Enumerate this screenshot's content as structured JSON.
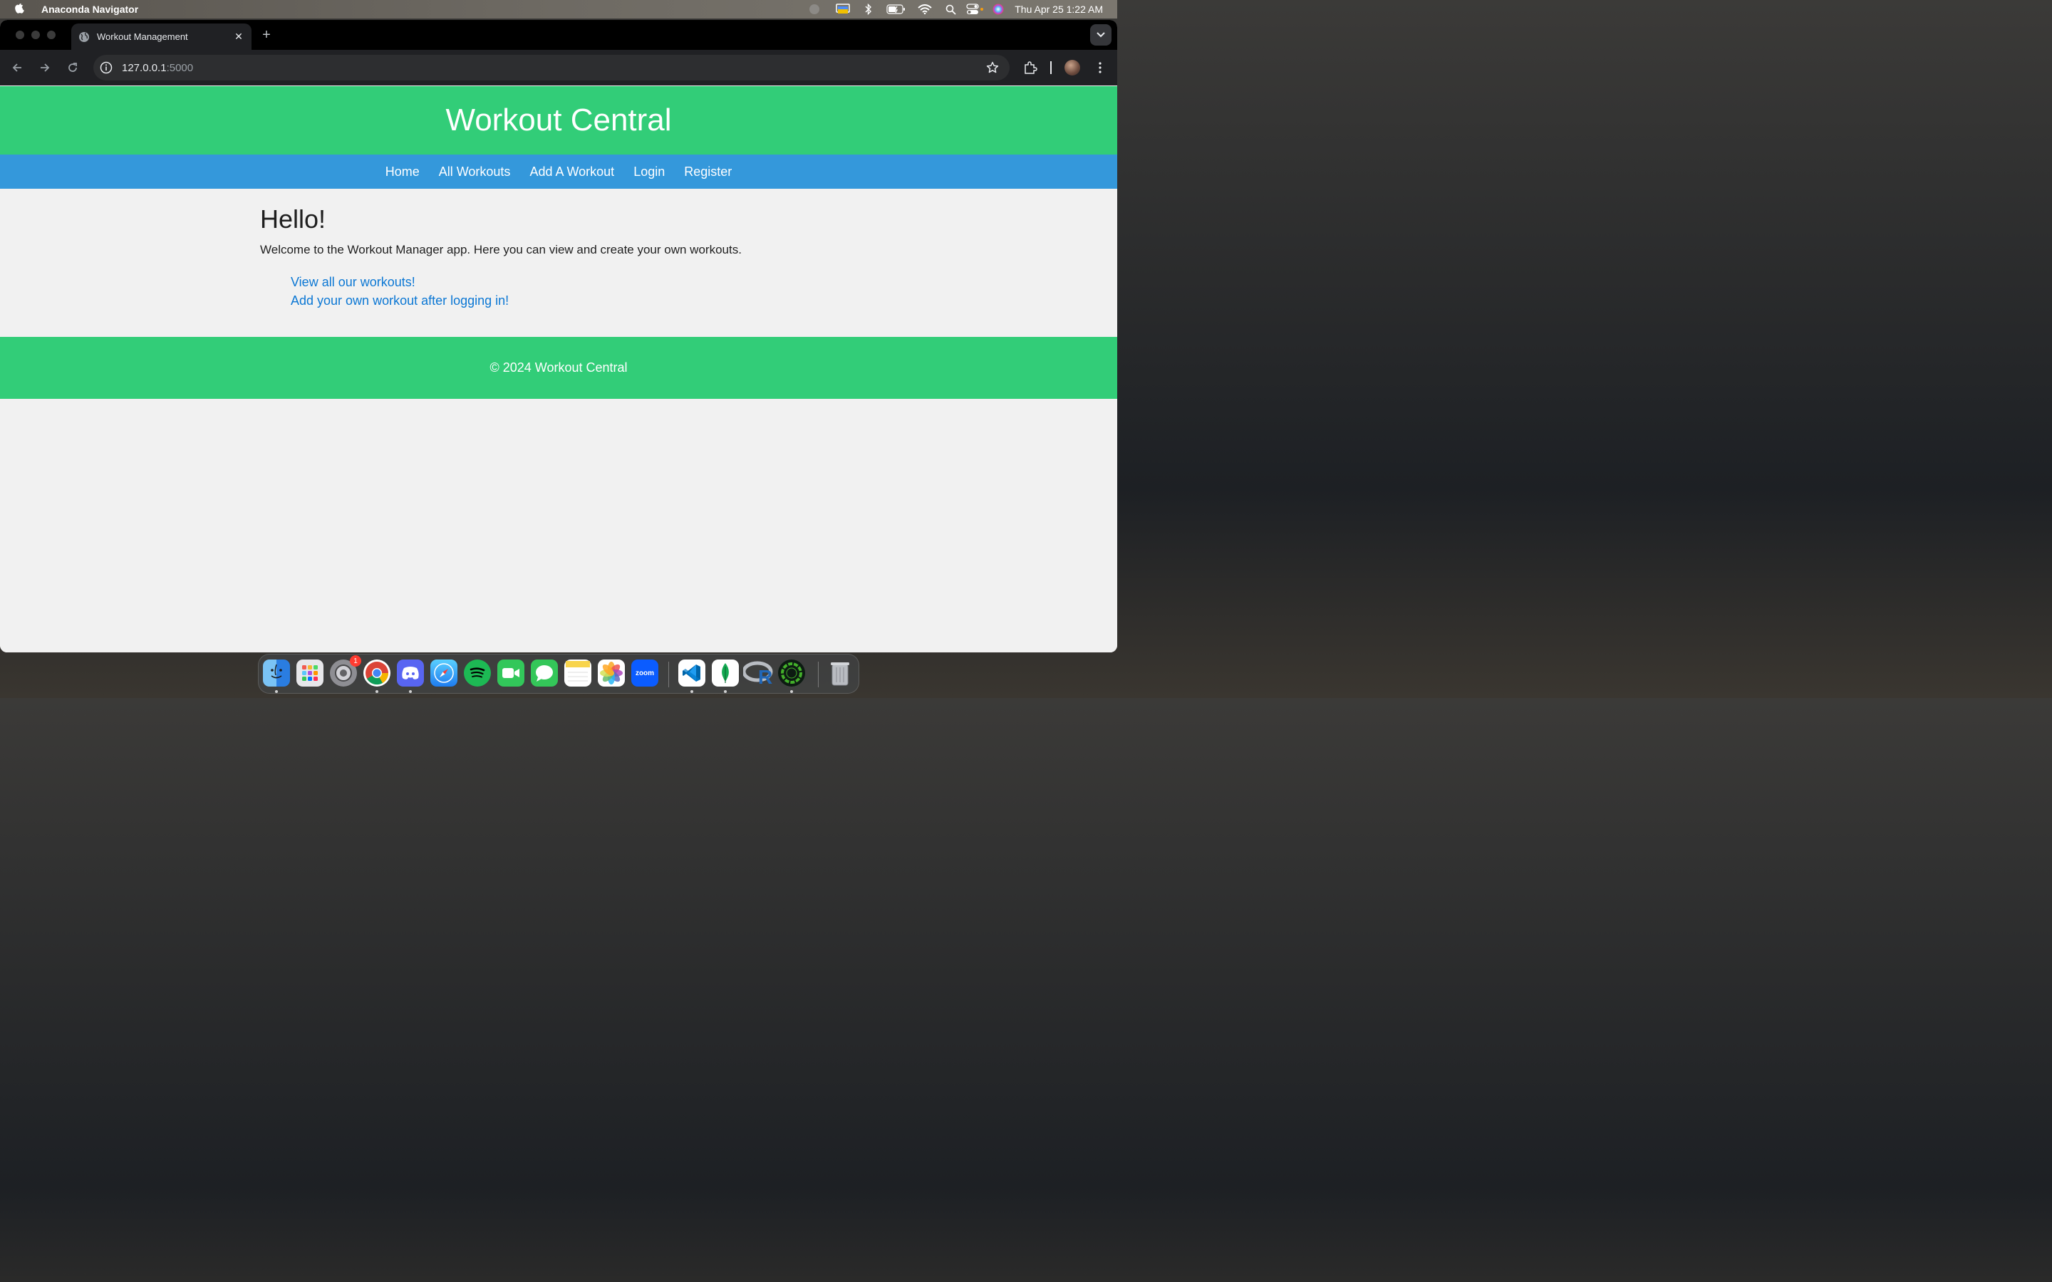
{
  "menubar": {
    "app_name": "Anaconda Navigator",
    "clock": "Thu Apr 25  1:22 AM"
  },
  "browser": {
    "tab_title": "Workout Management",
    "tab_close": "✕",
    "new_tab": "+",
    "url_host": "127.0.0.1",
    "url_port": ":5000"
  },
  "site": {
    "title": "Workout Central",
    "nav": [
      "Home",
      "All Workouts",
      "Add A Workout",
      "Login",
      "Register"
    ],
    "heading": "Hello!",
    "intro": "Welcome to the Workout Manager app. Here you can view and create your own workouts.",
    "links": [
      "View all our workouts!",
      "Add your own workout after logging in!"
    ],
    "footer": "© 2024 Workout Central"
  },
  "dock": {
    "settings_badge": "1",
    "zoom_label": "zoom"
  },
  "colors": {
    "header_green": "#32cd78",
    "nav_blue": "#3498db",
    "link_blue": "#0b77d4"
  }
}
